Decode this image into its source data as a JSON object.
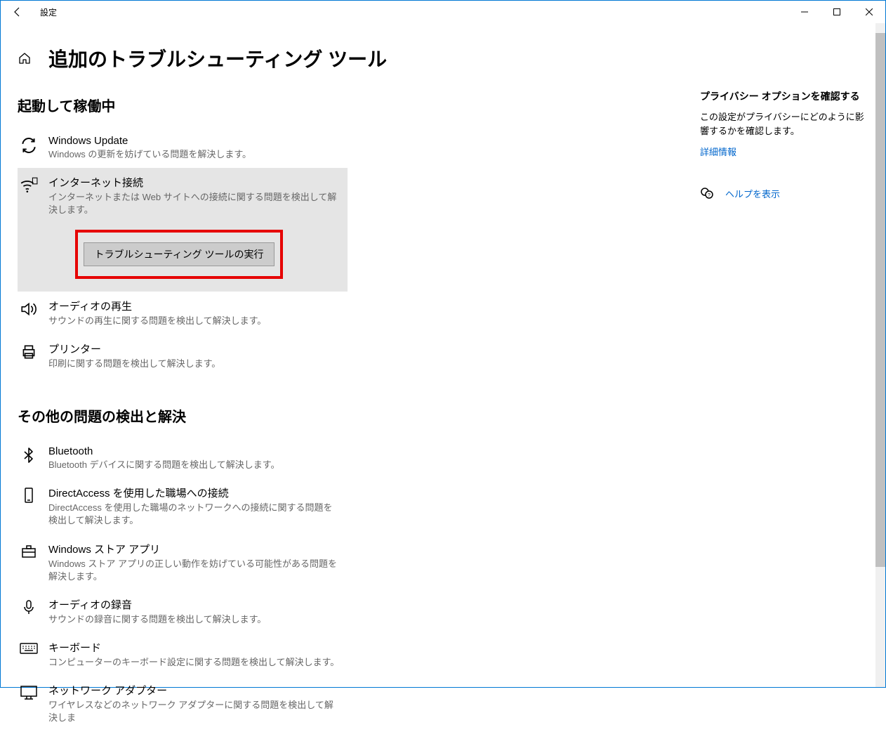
{
  "app_title": "設定",
  "page_title": "追加のトラブルシューティング ツール",
  "section1_title": "起動して稼働中",
  "section2_title": "その他の問題の検出と解決",
  "run_button": "トラブルシューティング ツールの実行",
  "items1": [
    {
      "name": "Windows Update",
      "desc": "Windows の更新を妨げている問題を解決します。"
    },
    {
      "name": "インターネット接続",
      "desc": "インターネットまたは Web サイトへの接続に関する問題を検出して解決します。"
    },
    {
      "name": "オーディオの再生",
      "desc": "サウンドの再生に関する問題を検出して解決します。"
    },
    {
      "name": "プリンター",
      "desc": "印刷に関する問題を検出して解決します。"
    }
  ],
  "items2": [
    {
      "name": "Bluetooth",
      "desc": "Bluetooth デバイスに関する問題を検出して解決します。"
    },
    {
      "name": "DirectAccess を使用した職場への接続",
      "desc": "DirectAccess を使用した職場のネットワークへの接続に関する問題を検出して解決します。"
    },
    {
      "name": "Windows ストア アプリ",
      "desc": "Windows ストア アプリの正しい動作を妨げている可能性がある問題を解決します。"
    },
    {
      "name": "オーディオの録音",
      "desc": "サウンドの録音に関する問題を検出して解決します。"
    },
    {
      "name": "キーボード",
      "desc": "コンピューターのキーボード設定に関する問題を検出して解決します。"
    },
    {
      "name": "ネットワーク アダプター",
      "desc": "ワイヤレスなどのネットワーク アダプターに関する問題を検出して解決しま"
    }
  ],
  "sidebar": {
    "privacy_title": "プライバシー オプションを確認する",
    "privacy_text": "この設定がプライバシーにどのように影響するかを確認します。",
    "privacy_link": "詳細情報",
    "help_link": "ヘルプを表示"
  }
}
